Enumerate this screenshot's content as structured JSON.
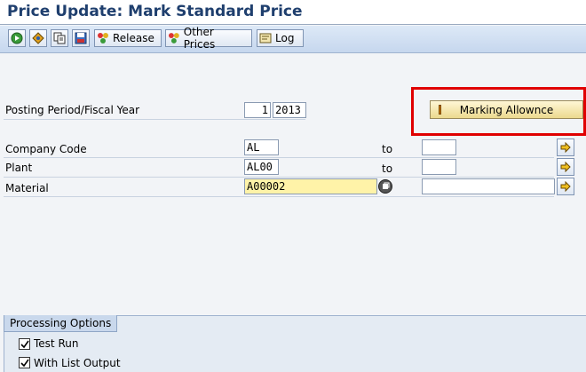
{
  "title": "Price Update: Mark Standard Price",
  "toolbar": {
    "release_label": "Release",
    "other_prices_label": "Other Prices",
    "log_label": "Log"
  },
  "posting": {
    "label": "Posting Period/Fiscal Year",
    "period": "1",
    "year": "2013"
  },
  "marking_button": "Marking Allownce",
  "selection": {
    "to_label": "to",
    "rows": [
      {
        "label": "Company Code",
        "from": "AL",
        "to": ""
      },
      {
        "label": "Plant",
        "from": "AL00",
        "to": ""
      },
      {
        "label": "Material",
        "from": "A00002",
        "to": ""
      }
    ]
  },
  "processing": {
    "title": "Processing Options",
    "test_run": "Test Run",
    "list_output": "With List Output"
  }
}
